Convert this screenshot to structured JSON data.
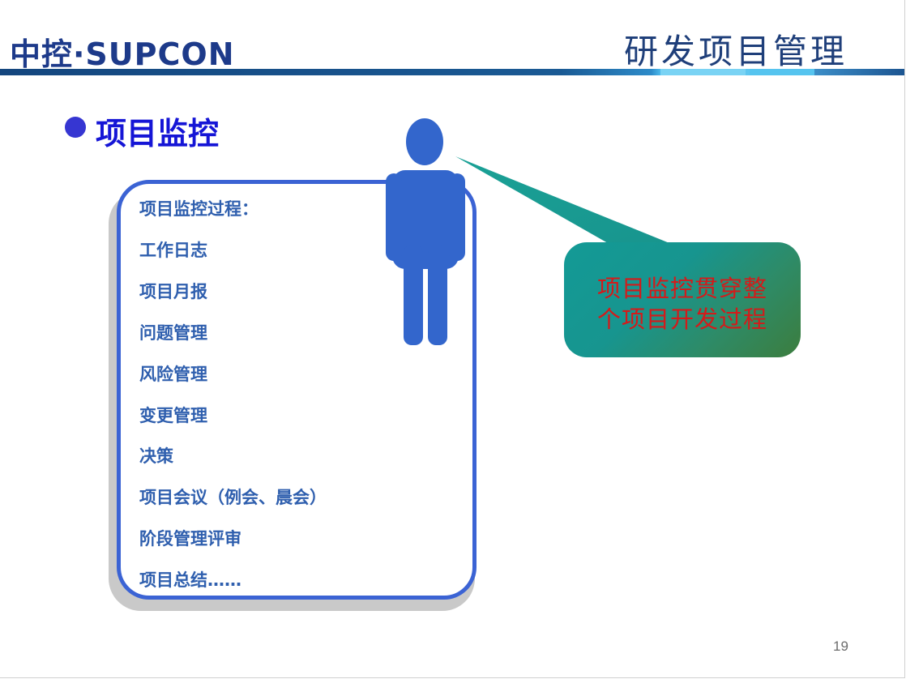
{
  "header": {
    "logo_text": "中控·SUPCON",
    "title": "研发项目管理"
  },
  "section": {
    "heading": "项目监控"
  },
  "list": {
    "items": [
      "项目监控过程：",
      "工作日志",
      "项目月报",
      "问题管理",
      "风险管理",
      "变更管理",
      "决策",
      "项目会议（例会、晨会）",
      "阶段管理评审",
      "项目总结……"
    ]
  },
  "callout": {
    "line1": "项目监控贯穿整",
    "line2": "个项目开发过程"
  },
  "footer": {
    "page_number": "19"
  },
  "colors": {
    "heading_blue": "#1515d6",
    "list_text": "#2f5fae",
    "list_border": "#3b63d4",
    "figure_blue": "#3366cc",
    "callout_text": "#d41a1a"
  }
}
